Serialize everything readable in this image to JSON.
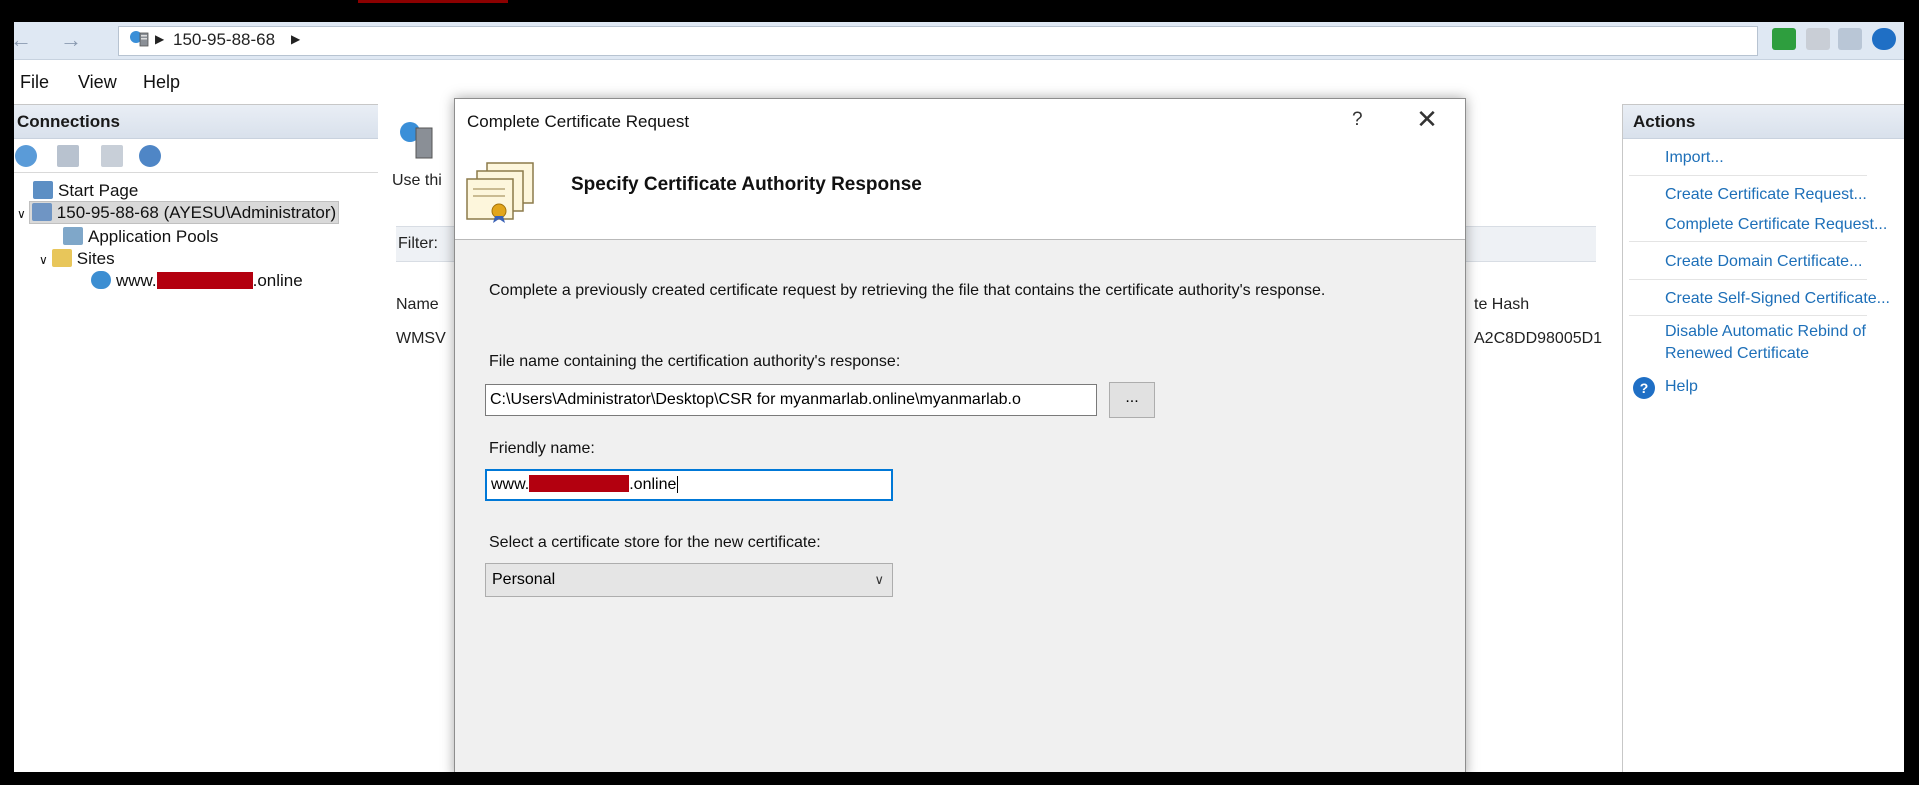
{
  "address": {
    "host": "150-95-88-68"
  },
  "menu": {
    "items": [
      "File",
      "View",
      "Help"
    ]
  },
  "connections": {
    "title": "Connections",
    "tree": [
      {
        "label": "Start Page"
      },
      {
        "label": "150-95-88-68 (AYESU\\Administrator)"
      },
      {
        "label": "Application Pools"
      },
      {
        "label": "Sites"
      },
      {
        "label_prefix": "www.",
        "label_suffix": ".online"
      }
    ]
  },
  "center": {
    "use_text": "Use thi",
    "filter_label": "Filter:",
    "col_name": "Name",
    "col_hash": "te Hash",
    "row_name": "WMSV",
    "row_hash": "A2C8DD98005D1"
  },
  "dialog": {
    "title": "Complete Certificate Request",
    "help": "?",
    "close": "✕",
    "heading": "Specify Certificate Authority Response",
    "description": "Complete a previously created certificate request by retrieving the file that contains the certificate authority's response.",
    "file_label": "File name containing the certification authority's response:",
    "file_value": "C:\\Users\\Administrator\\Desktop\\CSR for myanmarlab.online\\myanmarlab.o",
    "browse_label": "...",
    "friendly_label": "Friendly name:",
    "friendly_prefix": "www.",
    "friendly_suffix": ".online",
    "store_label": "Select a certificate store for the new certificate:",
    "store_value": "Personal"
  },
  "actions": {
    "title": "Actions",
    "links": [
      "Import...",
      "Create Certificate Request...",
      "Complete Certificate Request...",
      "Create Domain Certificate...",
      "Create Self-Signed Certificate...",
      "Disable Automatic Rebind of",
      "Renewed Certificate",
      "Help"
    ]
  },
  "colors": {
    "accent": "#1d6fb8",
    "focus": "#0078d7",
    "redaction": "#b3000f"
  }
}
